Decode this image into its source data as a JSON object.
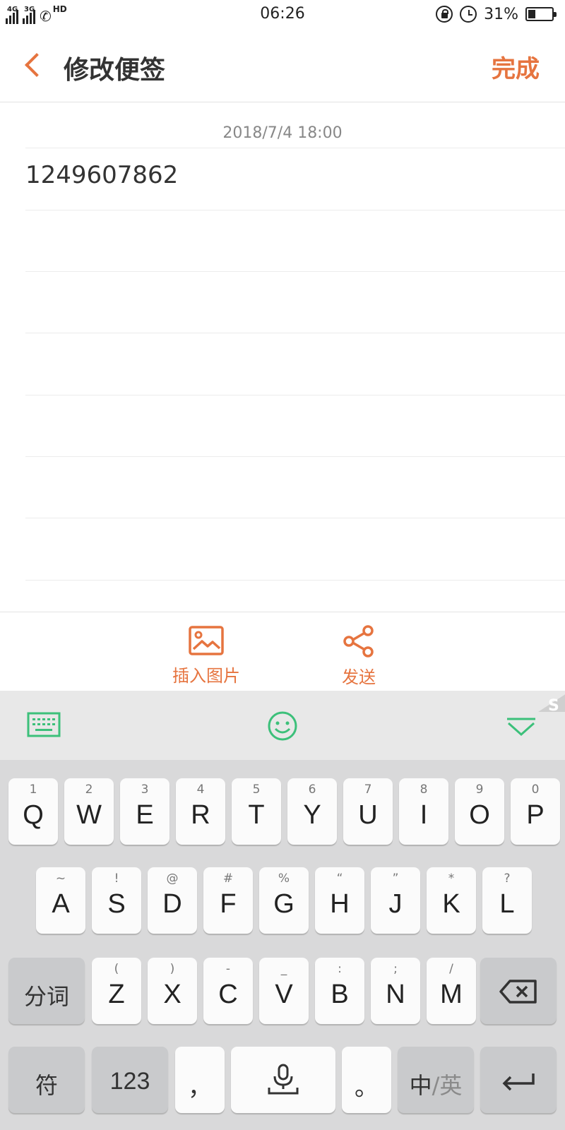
{
  "status_bar": {
    "sim1_net": "4G",
    "sim2_net": "3G",
    "hd": "HD",
    "time": "06:26",
    "battery_percent": "31%",
    "battery_level": 0.31
  },
  "header": {
    "title": "修改便签",
    "done_label": "完成"
  },
  "note": {
    "date": "2018/7/4 18:00",
    "content": "1249607862"
  },
  "actions": {
    "insert_image": "插入图片",
    "send": "发送"
  },
  "keyboard": {
    "row1": [
      {
        "num": "1",
        "key": "Q"
      },
      {
        "num": "2",
        "key": "W"
      },
      {
        "num": "3",
        "key": "E"
      },
      {
        "num": "4",
        "key": "R"
      },
      {
        "num": "5",
        "key": "T"
      },
      {
        "num": "6",
        "key": "Y"
      },
      {
        "num": "7",
        "key": "U"
      },
      {
        "num": "8",
        "key": "I"
      },
      {
        "num": "9",
        "key": "O"
      },
      {
        "num": "0",
        "key": "P"
      }
    ],
    "row2": [
      {
        "num": "~",
        "key": "A"
      },
      {
        "num": "!",
        "key": "S"
      },
      {
        "num": "@",
        "key": "D"
      },
      {
        "num": "#",
        "key": "F"
      },
      {
        "num": "%",
        "key": "G"
      },
      {
        "num": "“",
        "key": "H"
      },
      {
        "num": "”",
        "key": "J"
      },
      {
        "num": "*",
        "key": "K"
      },
      {
        "num": "?",
        "key": "L"
      }
    ],
    "row3": [
      {
        "num": "(",
        "key": "Z"
      },
      {
        "num": ")",
        "key": "X"
      },
      {
        "num": "-",
        "key": "C"
      },
      {
        "num": "_",
        "key": "V"
      },
      {
        "num": ":",
        "key": "B"
      },
      {
        "num": ";",
        "key": "N"
      },
      {
        "num": "/",
        "key": "M"
      }
    ],
    "segment_label": "分词",
    "symbols_label": "符",
    "numbers_label": "123",
    "comma_label": "，",
    "period_label": "。",
    "lang_zh": "中",
    "lang_sep": "/",
    "lang_en": "英"
  },
  "colors": {
    "accent": "#e6743f",
    "keyboard_green": "#3cc07a"
  }
}
